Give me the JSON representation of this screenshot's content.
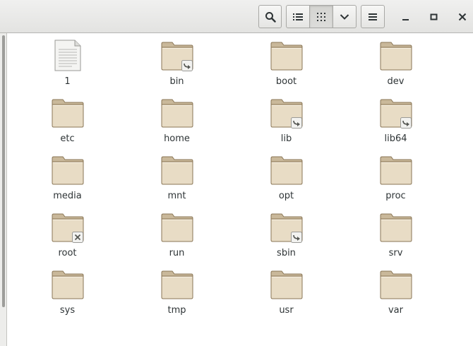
{
  "toolbar": {
    "search_icon": "search-icon",
    "list_view_icon": "list-view-icon",
    "grid_view_icon": "grid-view-icon",
    "view_options_icon": "chevron-down-icon",
    "menu_icon": "hamburger-menu-icon",
    "minimize_icon": "minimize-icon",
    "maximize_icon": "maximize-icon",
    "close_icon": "close-icon"
  },
  "colors": {
    "folder_body": "#e8dcc5",
    "folder_tab": "#c9b89a",
    "folder_edge": "#8a7656",
    "text": "#2e3436"
  },
  "files": [
    {
      "name": "1",
      "type": "file",
      "emblem": ""
    },
    {
      "name": "bin",
      "type": "folder",
      "emblem": "symlink"
    },
    {
      "name": "boot",
      "type": "folder",
      "emblem": ""
    },
    {
      "name": "dev",
      "type": "folder",
      "emblem": ""
    },
    {
      "name": "etc",
      "type": "folder",
      "emblem": ""
    },
    {
      "name": "home",
      "type": "folder",
      "emblem": ""
    },
    {
      "name": "lib",
      "type": "folder",
      "emblem": "symlink"
    },
    {
      "name": "lib64",
      "type": "folder",
      "emblem": "symlink"
    },
    {
      "name": "media",
      "type": "folder",
      "emblem": ""
    },
    {
      "name": "mnt",
      "type": "folder",
      "emblem": ""
    },
    {
      "name": "opt",
      "type": "folder",
      "emblem": ""
    },
    {
      "name": "proc",
      "type": "folder",
      "emblem": ""
    },
    {
      "name": "root",
      "type": "folder",
      "emblem": "unreadable"
    },
    {
      "name": "run",
      "type": "folder",
      "emblem": ""
    },
    {
      "name": "sbin",
      "type": "folder",
      "emblem": "symlink"
    },
    {
      "name": "srv",
      "type": "folder",
      "emblem": ""
    },
    {
      "name": "sys",
      "type": "folder",
      "emblem": ""
    },
    {
      "name": "tmp",
      "type": "folder",
      "emblem": ""
    },
    {
      "name": "usr",
      "type": "folder",
      "emblem": ""
    },
    {
      "name": "var",
      "type": "folder",
      "emblem": ""
    }
  ]
}
